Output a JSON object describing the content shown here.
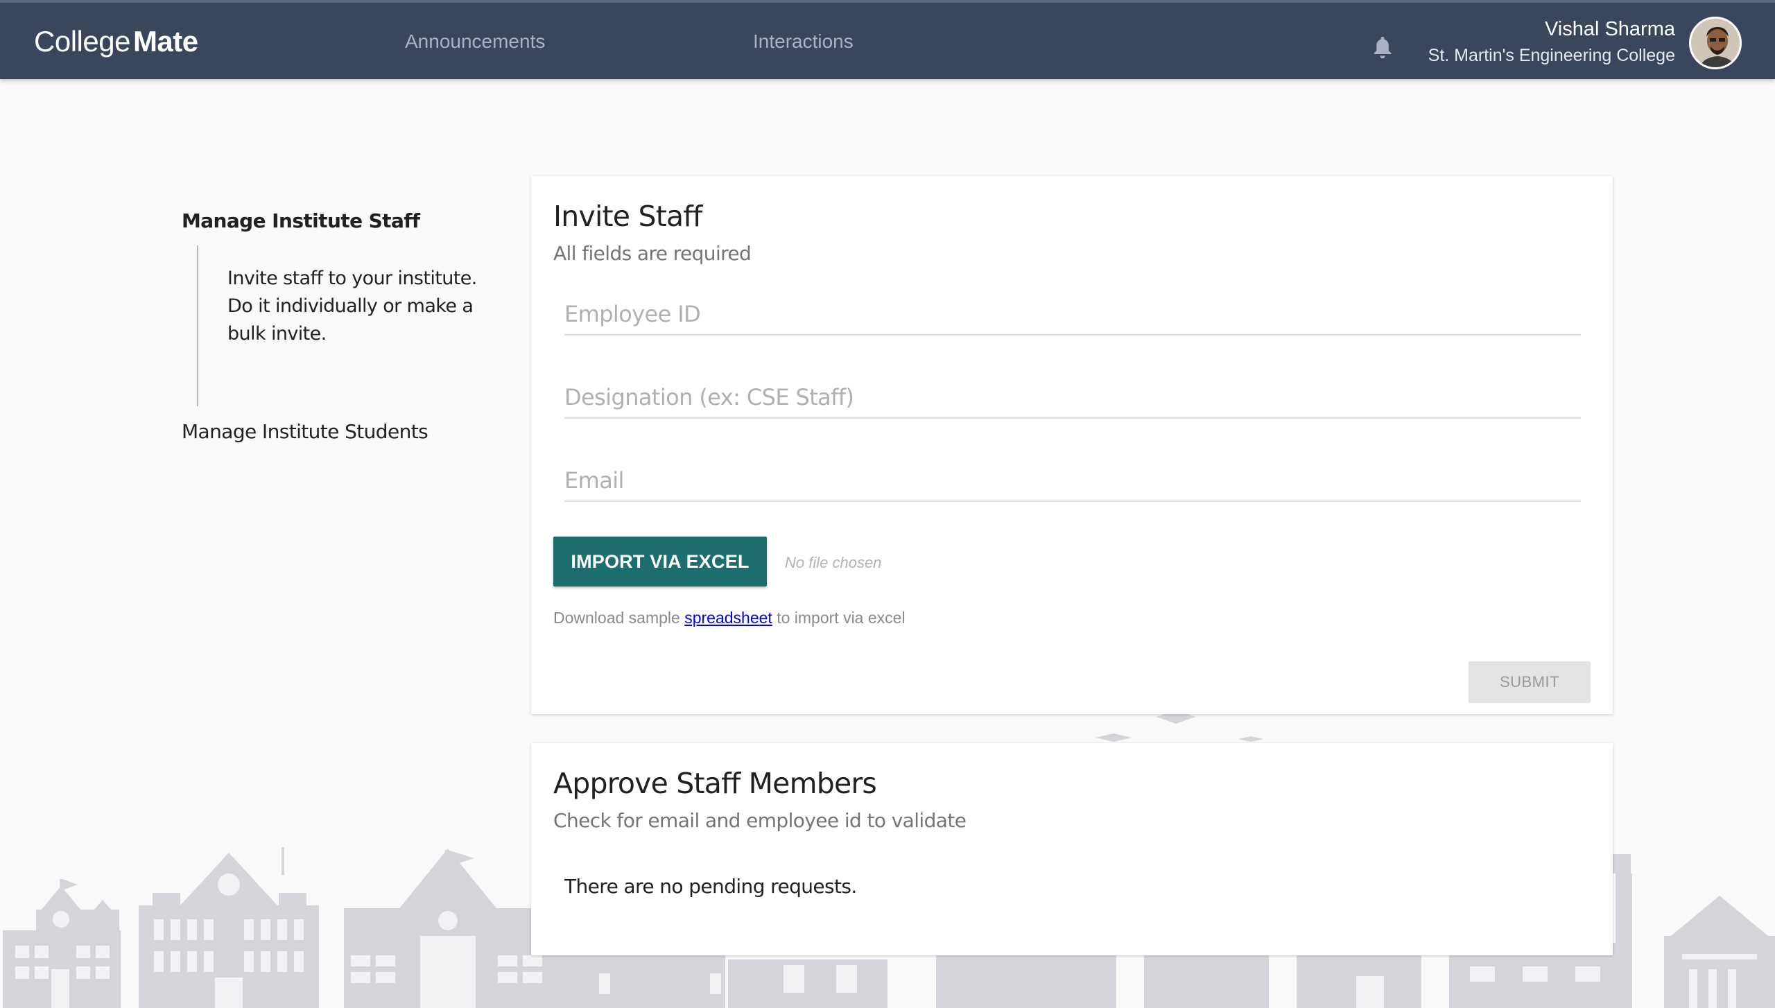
{
  "header": {
    "logo_light": "College",
    "logo_bold": "Mate",
    "nav": {
      "announcements": "Announcements",
      "interactions": "Interactions"
    },
    "notification_icon": "bell-icon",
    "user": {
      "name": "Vishal Sharma",
      "college": "St. Martin's Engineering College"
    }
  },
  "sidebar": {
    "active_heading": "Manage Institute Staff",
    "description": "Invite staff to your institute. Do it individually or make a bulk invite.",
    "students_link": "Manage Institute Students"
  },
  "invite_card": {
    "title": "Invite Staff",
    "subtitle": "All fields are required",
    "fields": {
      "employee_id_placeholder": "Employee ID",
      "designation_placeholder": "Designation (ex: CSE Staff)",
      "email_placeholder": "Email"
    },
    "import_button": "IMPORT VIA EXCEL",
    "file_status": "No file chosen",
    "download_prefix": "Download sample ",
    "download_link": "spreadsheet",
    "download_suffix": " to import via excel",
    "submit_button": "SUBMIT"
  },
  "approve_card": {
    "title": "Approve Staff Members",
    "subtitle": "Check for email and employee id to validate",
    "empty_message": "There are no pending requests."
  },
  "colors": {
    "header_bg": "#3a465c",
    "primary_button": "#1d6f6f",
    "page_bg": "#f9f9f9",
    "skyline": "#d4d5da"
  }
}
